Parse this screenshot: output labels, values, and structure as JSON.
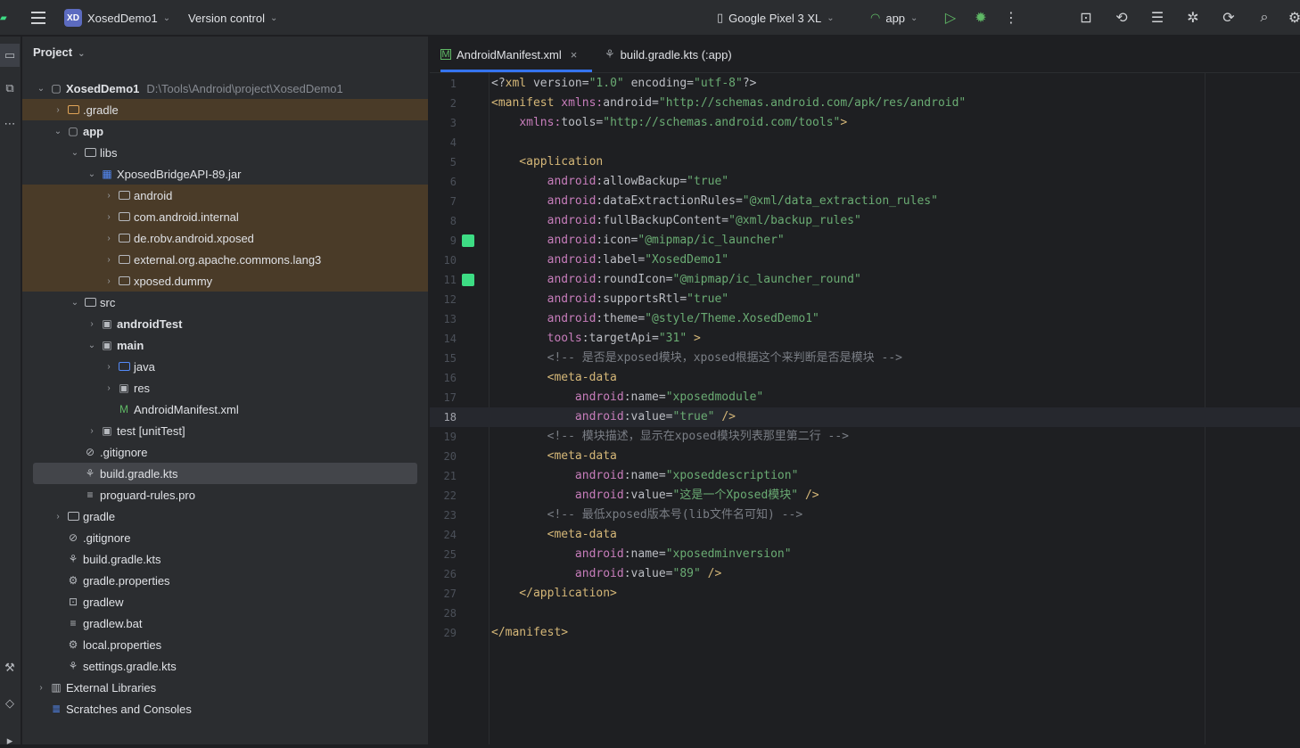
{
  "titlebar": {
    "project_badge": "XD",
    "project_name": "XosedDemo1",
    "vcs": "Version control",
    "device": "Google Pixel 3 XL",
    "run_config": "app"
  },
  "project_panel": {
    "title": "Project",
    "tree": [
      {
        "label": "XosedDemo1",
        "path": "D:\\Tools\\Android\\project\\XosedDemo1",
        "depth": 0,
        "arrow": "v",
        "icon": "module",
        "bold": true
      },
      {
        "label": ".gradle",
        "depth": 1,
        "arrow": ">",
        "icon": "folder-orange",
        "hl": true
      },
      {
        "label": "app",
        "depth": 1,
        "arrow": "v",
        "icon": "module",
        "bold": true
      },
      {
        "label": "libs",
        "depth": 2,
        "arrow": "v",
        "icon": "folder"
      },
      {
        "label": "XposedBridgeAPI-89.jar",
        "depth": 3,
        "arrow": "v",
        "icon": "jar"
      },
      {
        "label": "android",
        "depth": 4,
        "arrow": ">",
        "icon": "folder",
        "hl": true
      },
      {
        "label": "com.android.internal",
        "depth": 4,
        "arrow": ">",
        "icon": "folder",
        "hl": true
      },
      {
        "label": "de.robv.android.xposed",
        "depth": 4,
        "arrow": ">",
        "icon": "folder",
        "hl": true
      },
      {
        "label": "external.org.apache.commons.lang3",
        "depth": 4,
        "arrow": ">",
        "icon": "folder",
        "hl": true
      },
      {
        "label": "xposed.dummy",
        "depth": 4,
        "arrow": ">",
        "icon": "folder",
        "hl": true
      },
      {
        "label": "src",
        "depth": 2,
        "arrow": "v",
        "icon": "folder"
      },
      {
        "label": "androidTest",
        "depth": 3,
        "arrow": ">",
        "icon": "folder-res",
        "bold": true
      },
      {
        "label": "main",
        "depth": 3,
        "arrow": "v",
        "icon": "folder-res",
        "bold": true
      },
      {
        "label": "java",
        "depth": 4,
        "arrow": ">",
        "icon": "folder-blue"
      },
      {
        "label": "res",
        "depth": 4,
        "arrow": ">",
        "icon": "folder-res"
      },
      {
        "label": "AndroidManifest.xml",
        "depth": 4,
        "arrow": "",
        "icon": "manifest"
      },
      {
        "label": "test [unitTest]",
        "depth": 3,
        "arrow": ">",
        "icon": "folder-res"
      },
      {
        "label": ".gitignore",
        "depth": 2,
        "arrow": "",
        "icon": "ignore"
      },
      {
        "label": "build.gradle.kts",
        "depth": 2,
        "arrow": "",
        "icon": "gradle",
        "sel": true
      },
      {
        "label": "proguard-rules.pro",
        "depth": 2,
        "arrow": "",
        "icon": "text"
      },
      {
        "label": "gradle",
        "depth": 1,
        "arrow": ">",
        "icon": "folder"
      },
      {
        "label": ".gitignore",
        "depth": 1,
        "arrow": "",
        "icon": "ignore"
      },
      {
        "label": "build.gradle.kts",
        "depth": 1,
        "arrow": "",
        "icon": "gradle"
      },
      {
        "label": "gradle.properties",
        "depth": 1,
        "arrow": "",
        "icon": "gear"
      },
      {
        "label": "gradlew",
        "depth": 1,
        "arrow": "",
        "icon": "terminal"
      },
      {
        "label": "gradlew.bat",
        "depth": 1,
        "arrow": "",
        "icon": "text"
      },
      {
        "label": "local.properties",
        "depth": 1,
        "arrow": "",
        "icon": "gear"
      },
      {
        "label": "settings.gradle.kts",
        "depth": 1,
        "arrow": "",
        "icon": "gradle"
      },
      {
        "label": "External Libraries",
        "depth": 0,
        "arrow": ">",
        "icon": "library"
      },
      {
        "label": "Scratches and Consoles",
        "depth": 0,
        "arrow": "",
        "icon": "scratch"
      }
    ]
  },
  "editor": {
    "tabs": [
      {
        "label": "AndroidManifest.xml",
        "active": true
      },
      {
        "label": "build.gradle.kts (:app)",
        "active": false
      }
    ],
    "current_line": 18,
    "lines": [
      [
        [
          "pun",
          "<?"
        ],
        [
          "tag",
          "xml "
        ],
        [
          "attr",
          "version="
        ],
        [
          "val",
          "\"1.0\" "
        ],
        [
          "attr",
          "encoding="
        ],
        [
          "val",
          "\"utf-8\""
        ],
        [
          "pun",
          "?>"
        ]
      ],
      [
        [
          "tag",
          "<manifest "
        ],
        [
          "ns",
          "xmlns:"
        ],
        [
          "attr",
          "android="
        ],
        [
          "val",
          "\"http://schemas.android.com/apk/res/android\""
        ]
      ],
      [
        [
          "attr",
          "    "
        ],
        [
          "ns",
          "xmlns:"
        ],
        [
          "attr",
          "tools="
        ],
        [
          "val",
          "\"http://schemas.android.com/tools\""
        ],
        [
          "tag",
          ">"
        ]
      ],
      [],
      [
        [
          "tag",
          "    <application"
        ]
      ],
      [
        [
          "ns",
          "        android"
        ],
        [
          "attr",
          ":allowBackup="
        ],
        [
          "val",
          "\"true\""
        ]
      ],
      [
        [
          "ns",
          "        android"
        ],
        [
          "attr",
          ":dataExtractionRules="
        ],
        [
          "val",
          "\"@xml/data_extraction_rules\""
        ]
      ],
      [
        [
          "ns",
          "        android"
        ],
        [
          "attr",
          ":fullBackupContent="
        ],
        [
          "val",
          "\"@xml/backup_rules\""
        ]
      ],
      [
        [
          "ns",
          "        android"
        ],
        [
          "attr",
          ":icon="
        ],
        [
          "val",
          "\"@mipmap/ic_launcher\""
        ]
      ],
      [
        [
          "ns",
          "        android"
        ],
        [
          "attr",
          ":label="
        ],
        [
          "val",
          "\"XosedDemo1\""
        ]
      ],
      [
        [
          "ns",
          "        android"
        ],
        [
          "attr",
          ":roundIcon="
        ],
        [
          "val",
          "\"@mipmap/ic_launcher_round\""
        ]
      ],
      [
        [
          "ns",
          "        android"
        ],
        [
          "attr",
          ":supportsRtl="
        ],
        [
          "val",
          "\"true\""
        ]
      ],
      [
        [
          "ns",
          "        android"
        ],
        [
          "attr",
          ":theme="
        ],
        [
          "val",
          "\"@style/Theme.XosedDemo1\""
        ]
      ],
      [
        [
          "ns",
          "        tools"
        ],
        [
          "attr",
          ":targetApi="
        ],
        [
          "val",
          "\"31\""
        ],
        [
          "tag",
          " >"
        ]
      ],
      [
        [
          "com",
          "        <!-- 是否是xposed模块，xposed根据这个来判断是否是模块 -->"
        ]
      ],
      [
        [
          "tag",
          "        <meta-data"
        ]
      ],
      [
        [
          "ns",
          "            android"
        ],
        [
          "attr",
          ":name="
        ],
        [
          "val",
          "\"xposedmodule\""
        ]
      ],
      [
        [
          "ns",
          "            android"
        ],
        [
          "attr",
          ":value="
        ],
        [
          "val",
          "\"true\" "
        ],
        [
          "tag",
          "/>"
        ]
      ],
      [
        [
          "com",
          "        <!-- 模块描述，显示在xposed模块列表那里第二行 -->"
        ]
      ],
      [
        [
          "tag",
          "        <meta-data"
        ]
      ],
      [
        [
          "ns",
          "            android"
        ],
        [
          "attr",
          ":name="
        ],
        [
          "val",
          "\"xposeddescription\""
        ]
      ],
      [
        [
          "ns",
          "            android"
        ],
        [
          "attr",
          ":value="
        ],
        [
          "val",
          "\"这是一个Xposed模块\" "
        ],
        [
          "tag",
          "/>"
        ]
      ],
      [
        [
          "com",
          "        <!-- 最低xposed版本号(lib文件名可知) -->"
        ]
      ],
      [
        [
          "tag",
          "        <meta-data"
        ]
      ],
      [
        [
          "ns",
          "            android"
        ],
        [
          "attr",
          ":name="
        ],
        [
          "val",
          "\"xposedminversion\""
        ]
      ],
      [
        [
          "ns",
          "            android"
        ],
        [
          "attr",
          ":value="
        ],
        [
          "val",
          "\"89\" "
        ],
        [
          "tag",
          "/>"
        ]
      ],
      [
        [
          "tag",
          "    </application>"
        ]
      ],
      [],
      [
        [
          "tag",
          "</manifest>"
        ]
      ]
    ],
    "gutter_icons": [
      9,
      11
    ]
  },
  "colors": {
    "accent": "#3574f0",
    "android_green": "#3ddc84",
    "run_green": "#5fb865"
  }
}
